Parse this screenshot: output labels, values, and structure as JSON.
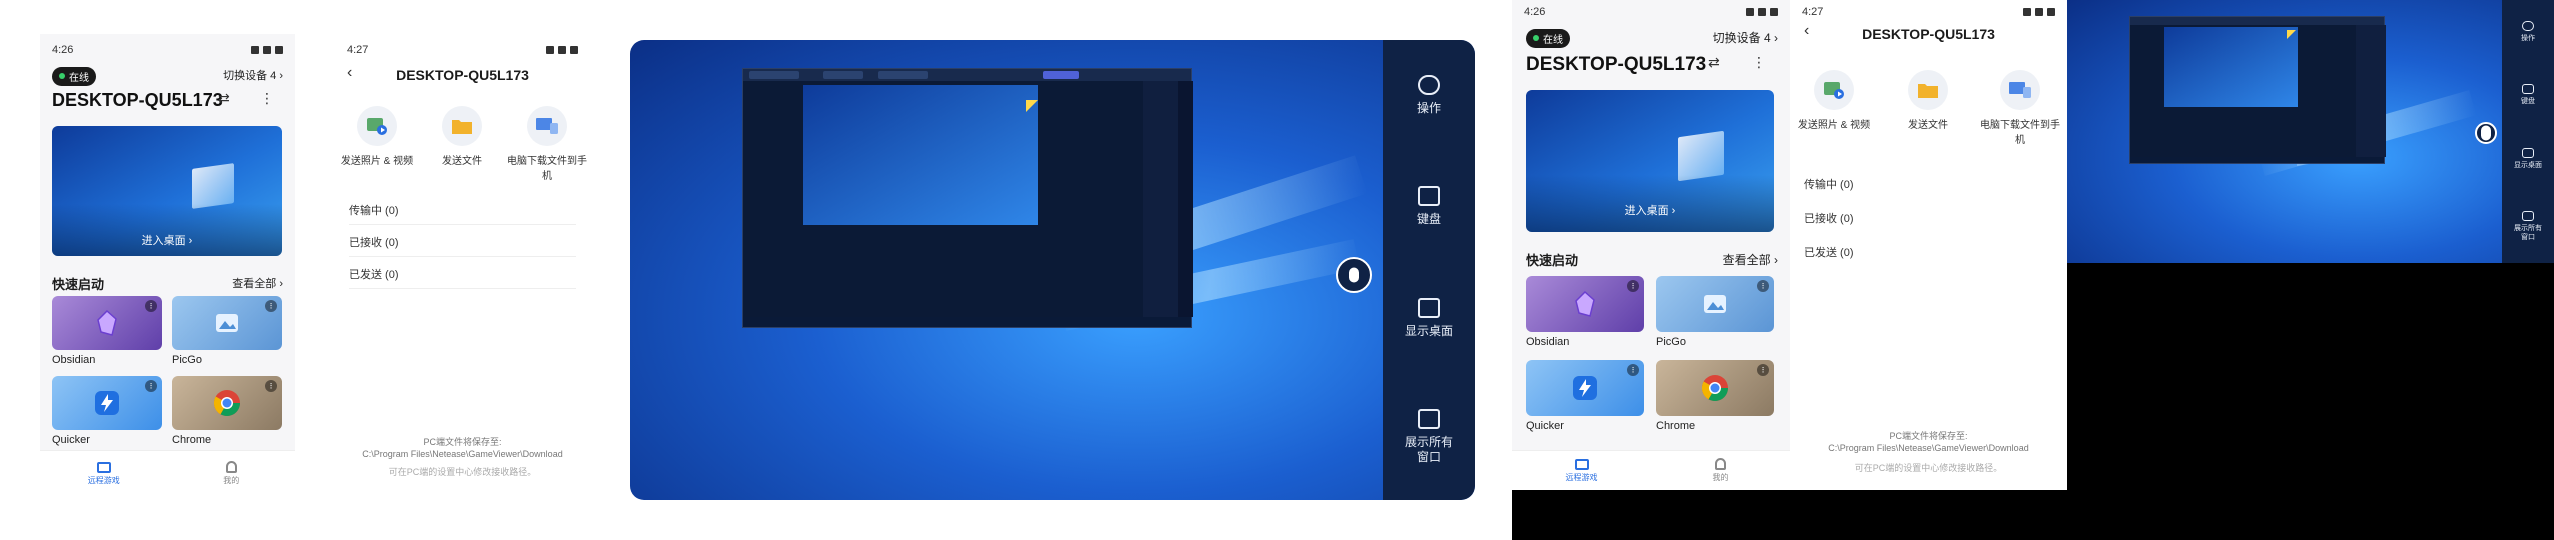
{
  "device": {
    "name": "DESKTOP-QU5L173",
    "online_label": "在线",
    "switch_label": "切换设备 4 ›",
    "enter_desktop": "进入桌面 ›"
  },
  "status": {
    "time_a": "4:26",
    "time_b": "4:27"
  },
  "quick": {
    "title": "快速启动",
    "see_all": "查看全部 ›",
    "apps": [
      {
        "name": "Obsidian"
      },
      {
        "name": "PicGo"
      },
      {
        "name": "Quicker"
      },
      {
        "name": "Chrome"
      }
    ]
  },
  "nav": {
    "remote": "远程游戏",
    "me": "我的"
  },
  "files": {
    "title": "DESKTOP-QU5L173",
    "actions": [
      "发送照片 & 视频",
      "发送文件",
      "电脑下载文件到手机"
    ],
    "rows": [
      "传输中 (0)",
      "已接收 (0)",
      "已发送 (0)"
    ],
    "note_line1": "PC端文件将保存至:",
    "note_line2": "C:\\Program Files\\Netease\\GameViewer\\Download",
    "note_line3": "可在PC端的设置中心修改接收路径。"
  },
  "remote_panel": {
    "items": [
      "操作",
      "键盘",
      "显示桌面",
      "展示所有窗口"
    ]
  },
  "colors": {
    "accent": "#2a6fe0",
    "panel": "#0f2245",
    "online": "#38d06b"
  }
}
